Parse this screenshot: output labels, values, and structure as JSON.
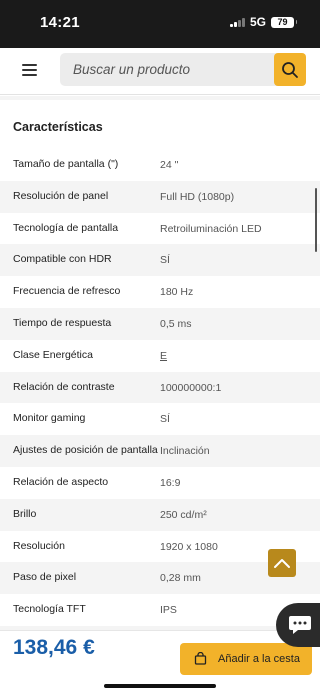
{
  "status": {
    "time": "14:21",
    "network": "5G",
    "battery": "79"
  },
  "search": {
    "placeholder": "Buscar un producto"
  },
  "section": {
    "title": "Características"
  },
  "specs": [
    {
      "label": "Tamaño de pantalla (\")",
      "value": "24 \""
    },
    {
      "label": "Resolución de panel",
      "value": "Full HD (1080p)"
    },
    {
      "label": "Tecnología de pantalla",
      "value": "Retroiluminación LED"
    },
    {
      "label": "Compatible con HDR",
      "value": "SÍ"
    },
    {
      "label": "Frecuencia de refresco",
      "value": "180 Hz"
    },
    {
      "label": "Tiempo de respuesta",
      "value": "0,5 ms"
    },
    {
      "label": "Clase Energética",
      "value": "E"
    },
    {
      "label": "Relación de contraste",
      "value": "100000000:1"
    },
    {
      "label": "Monitor gaming",
      "value": "SÍ"
    },
    {
      "label": "Ajustes de posición de pantalla",
      "value": "Inclinación"
    },
    {
      "label": "Relación de aspecto",
      "value": "16:9"
    },
    {
      "label": "Brillo",
      "value": "250 cd/m²"
    },
    {
      "label": "Resolución",
      "value": "1920 x 1080"
    },
    {
      "label": "Paso de pixel",
      "value": "0,28 mm"
    },
    {
      "label": "Tecnología TFT",
      "value": "IPS"
    }
  ],
  "footer": {
    "price": "138,46 €",
    "cart_label": "Añadir a la cesta"
  },
  "colors": {
    "accent": "#f2b22a",
    "price": "#1a5ea8",
    "scroll_top": "#b8891c"
  }
}
